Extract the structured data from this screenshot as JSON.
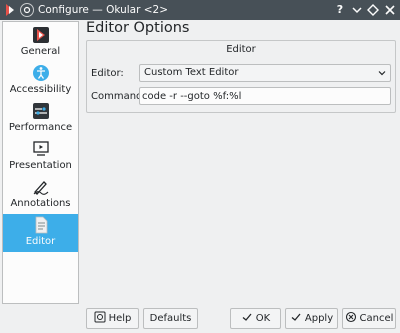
{
  "window": {
    "title": "Configure — Okular <2>",
    "buttons": {
      "help": "?",
      "minimize": "⌄",
      "maximize": "◇",
      "close": "×"
    }
  },
  "sidebar": {
    "items": [
      {
        "label": "General",
        "icon": "okular-icon"
      },
      {
        "label": "Accessibility",
        "icon": "accessibility-icon"
      },
      {
        "label": "Performance",
        "icon": "performance-icon"
      },
      {
        "label": "Presentation",
        "icon": "presentation-icon"
      },
      {
        "label": "Annotations",
        "icon": "annotations-icon"
      },
      {
        "label": "Editor",
        "icon": "editor-icon",
        "selected": true
      }
    ]
  },
  "page": {
    "title": "Editor Options",
    "group_title": "Editor",
    "editor_label": "Editor:",
    "editor_value": "Custom Text Editor",
    "command_label": "Command:",
    "command_value": "code -r --goto %f:%l"
  },
  "footer": {
    "help": "Help",
    "defaults": "Defaults",
    "ok": "OK",
    "apply": "Apply",
    "cancel": "Cancel"
  },
  "colors": {
    "titlebar": "#475057",
    "selection": "#3daee9",
    "window_bg": "#eff0f1",
    "view_bg": "#fcfcfc"
  }
}
